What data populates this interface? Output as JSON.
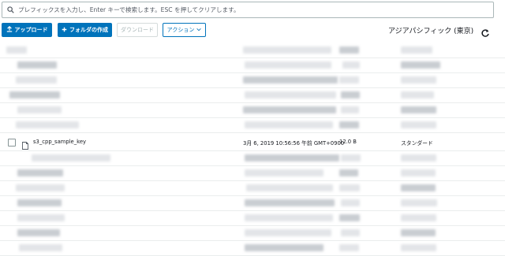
{
  "search": {
    "placeholder": "プレフィックスを入力し、Enter キーで検索します。ESC を押してクリアします。"
  },
  "toolbar": {
    "upload_label": "アップロード",
    "create_folder_label": "フォルダの作成",
    "download_label": "ダウンロード",
    "actions_label": "アクション",
    "region_label": "アジアパシフィック (東京)"
  },
  "visible_row": {
    "name": "s3_cpp_sample_key",
    "last_modified": "3月 6, 2019 10:56:56 午前 GMT+0900",
    "size": "12.0 B",
    "storage_class": "スタンダード"
  },
  "colors": {
    "primary": "#0073bb",
    "border": "#aab7b8",
    "divider": "#eaeded"
  }
}
